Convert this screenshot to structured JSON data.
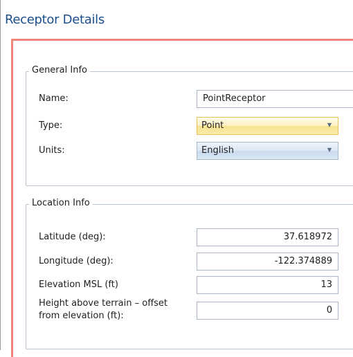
{
  "window": {
    "title": "Receptor Details"
  },
  "general_info": {
    "legend": "General Info",
    "name": {
      "label": "Name:",
      "value": "PointReceptor"
    },
    "type": {
      "label": "Type:",
      "value": "Point"
    },
    "units": {
      "label": "Units:",
      "value": "English"
    }
  },
  "location_info": {
    "legend": "Location Info",
    "latitude": {
      "label": "Latitude (deg):",
      "value": "37.618972"
    },
    "longitude": {
      "label": "Longitude (deg):",
      "value": "-122.374889"
    },
    "elevation": {
      "label": "Elevation MSL (ft)",
      "value": "13"
    },
    "height": {
      "label_line1": "Height above terrain – offset",
      "label_line2": "from elevation (ft):",
      "value": "0"
    }
  },
  "icons": {
    "dropdown": "chevron-down-icon"
  },
  "colors": {
    "title": "#1b4e8c",
    "panel_accent": "#f2857a",
    "group_border": "#b8c3d2"
  }
}
